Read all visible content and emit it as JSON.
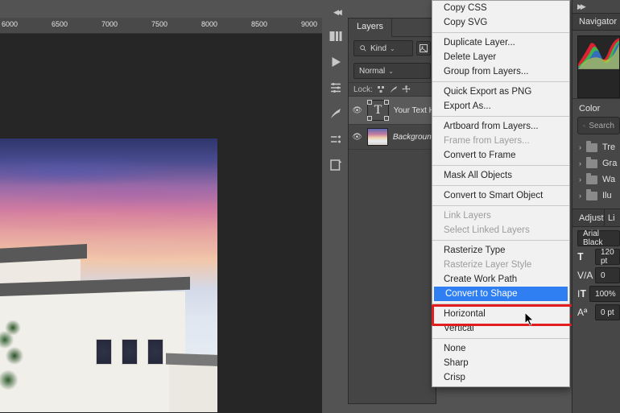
{
  "ruler": {
    "ticks": [
      "6000",
      "6500",
      "7000",
      "7500",
      "8000",
      "8500",
      "9000"
    ]
  },
  "layers": {
    "tab": "Layers",
    "kind_label": "Kind",
    "mode": "Normal",
    "lock_label": "Lock:",
    "layer1_name": "Your Text H",
    "layer2_name": "Background"
  },
  "menu": {
    "copy_css": "Copy CSS",
    "copy_svg": "Copy SVG",
    "duplicate": "Duplicate Layer...",
    "delete": "Delete Layer",
    "group": "Group from Layers...",
    "quick_export": "Quick Export as PNG",
    "export_as": "Export As...",
    "artboard": "Artboard from Layers...",
    "frame_from": "Frame from Layers...",
    "convert_frame": "Convert to Frame",
    "mask_all": "Mask All Objects",
    "smart_obj": "Convert to Smart Object",
    "link": "Link Layers",
    "sel_linked": "Select Linked Layers",
    "rast_type": "Rasterize Type",
    "rast_style": "Rasterize Layer Style",
    "work_path": "Create Work Path",
    "to_shape": "Convert to Shape",
    "horizontal": "Horizontal",
    "vertical": "Vertical",
    "none": "None",
    "sharp": "Sharp",
    "crisp": "Crisp"
  },
  "right": {
    "nav_tab": "Navigator",
    "color_tab": "Color",
    "search_ph": "Search",
    "folders": [
      "Tre",
      "Gra",
      "Wa",
      "Ilu"
    ],
    "adjust_tab1": "Adjust",
    "adjust_tab2": "Li",
    "font": "Arial Black",
    "size": "120 pt",
    "leading": "0",
    "percent": "100%",
    "baseline": "0 pt"
  }
}
